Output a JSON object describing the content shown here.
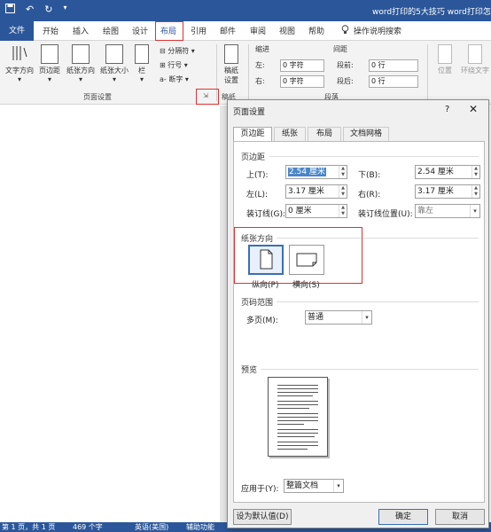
{
  "window": {
    "title": "word打印的5大技巧 word打印怎么",
    "qat": {
      "save_icon": "save-icon",
      "undo": "↶",
      "redo": "↻",
      "customize": "▾"
    }
  },
  "tabs": [
    "文件",
    "开始",
    "插入",
    "绘图",
    "设计",
    "布局",
    "引用",
    "邮件",
    "审阅",
    "视图",
    "帮助"
  ],
  "active_tab": "布局",
  "tell_me": "操作说明搜索",
  "ribbon": {
    "text_direction": "文字方向",
    "margins": "页边距",
    "orientation": "纸张方向",
    "size": "纸张大小",
    "columns": "栏",
    "breaks": "分隔符",
    "line_numbers": "行号",
    "hyphenation": "断字",
    "page_setup_group": "页面设置",
    "paper_setup": "稿纸设置",
    "paper_group": "稿纸",
    "indent_label": "缩进",
    "indent_left": "左:",
    "indent_left_val": "0 字符",
    "indent_right": "右:",
    "indent_right_val": "0 字符",
    "spacing_label": "间距",
    "spacing_before": "段前:",
    "spacing_before_val": "0 行",
    "spacing_after": "段后:",
    "spacing_after_val": "0 行",
    "paragraph_group": "段落",
    "position": "位置",
    "wrap_text": "环绕文字"
  },
  "statusbar": {
    "page": "第 1 页，共 1 页",
    "words": "469 个字",
    "language": "英语(美国)",
    "accessibility": "辅助功能"
  },
  "dialog": {
    "title": "页面设置",
    "help": "?",
    "close": "✕",
    "tabs": [
      "页边距",
      "纸张",
      "布局",
      "文档网格"
    ],
    "margins_section": "页边距",
    "top_label": "上(T):",
    "top_value": "2.54 厘米",
    "bottom_label": "下(B):",
    "bottom_value": "2.54 厘米",
    "left_label": "左(L):",
    "left_value": "3.17 厘米",
    "right_label": "右(R):",
    "right_value": "3.17 厘米",
    "gutter_label": "装订线(G):",
    "gutter_value": "0 厘米",
    "gutter_pos_label": "装订线位置(U):",
    "gutter_pos_value": "靠左",
    "orientation_section": "纸张方向",
    "portrait": "纵向(P)",
    "landscape": "横向(S)",
    "pages_section": "页码范围",
    "multiple_pages_label": "多页(M):",
    "multiple_pages_value": "普通",
    "preview_section": "预览",
    "apply_to_label": "应用于(Y):",
    "apply_to_value": "整篇文档",
    "set_default": "设为默认值(D)",
    "ok": "确定",
    "cancel": "取消"
  }
}
